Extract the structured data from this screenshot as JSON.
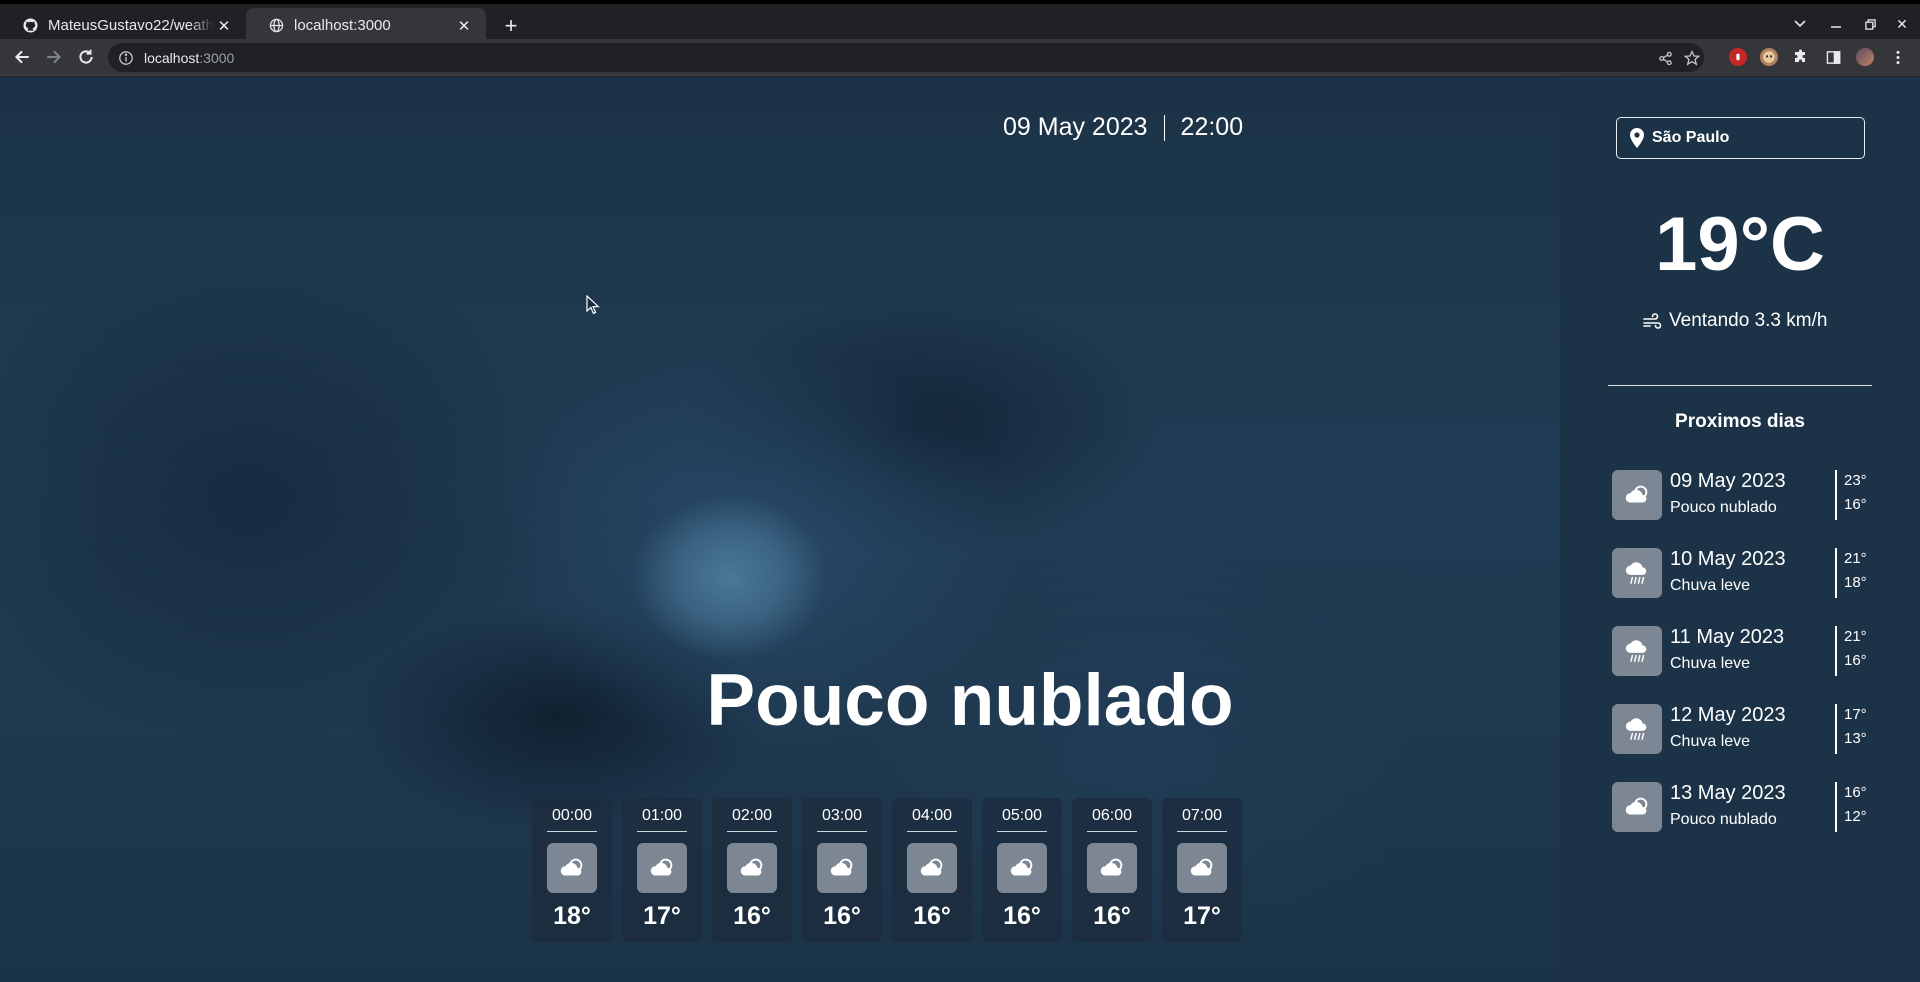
{
  "browser": {
    "tabs": [
      {
        "title": "MateusGustavo22/weath",
        "favicon": "github-icon",
        "active": false
      },
      {
        "title": "localhost:3000",
        "favicon": "globe-icon",
        "active": true
      }
    ],
    "address": {
      "host": "localhost",
      "port": ":3000"
    }
  },
  "header": {
    "date": "09 May 2023",
    "time": "22:00"
  },
  "condition": "Pouco nublado",
  "hourly": [
    {
      "time": "00:00",
      "temp": "18°",
      "icon": "cloud-icon"
    },
    {
      "time": "01:00",
      "temp": "17°",
      "icon": "cloud-icon"
    },
    {
      "time": "02:00",
      "temp": "16°",
      "icon": "cloud-icon"
    },
    {
      "time": "03:00",
      "temp": "16°",
      "icon": "cloud-icon"
    },
    {
      "time": "04:00",
      "temp": "16°",
      "icon": "cloud-icon"
    },
    {
      "time": "05:00",
      "temp": "16°",
      "icon": "cloud-icon"
    },
    {
      "time": "06:00",
      "temp": "16°",
      "icon": "cloud-icon"
    },
    {
      "time": "07:00",
      "temp": "17°",
      "icon": "cloud-icon"
    }
  ],
  "sidebar": {
    "location": "São Paulo",
    "temperature": "19°C",
    "wind": "Ventando 3.3 km/h",
    "next_title": "Proximos dias",
    "days": [
      {
        "date": "09 May 2023",
        "desc": "Pouco nublado",
        "max": "23°",
        "min": "16°",
        "icon": "cloud-icon"
      },
      {
        "date": "10 May 2023",
        "desc": "Chuva leve",
        "max": "21°",
        "min": "18°",
        "icon": "rain-icon"
      },
      {
        "date": "11 May 2023",
        "desc": "Chuva leve",
        "max": "21°",
        "min": "16°",
        "icon": "rain-icon"
      },
      {
        "date": "12 May 2023",
        "desc": "Chuva leve",
        "max": "17°",
        "min": "13°",
        "icon": "rain-icon"
      },
      {
        "date": "13 May 2023",
        "desc": "Pouco nublado",
        "max": "16°",
        "min": "12°",
        "icon": "cloud-icon"
      }
    ]
  },
  "colors": {
    "sidebar_bg": "#1b3247",
    "icon_tile": "#7d8794",
    "hour_card": "#1c2c3e"
  }
}
